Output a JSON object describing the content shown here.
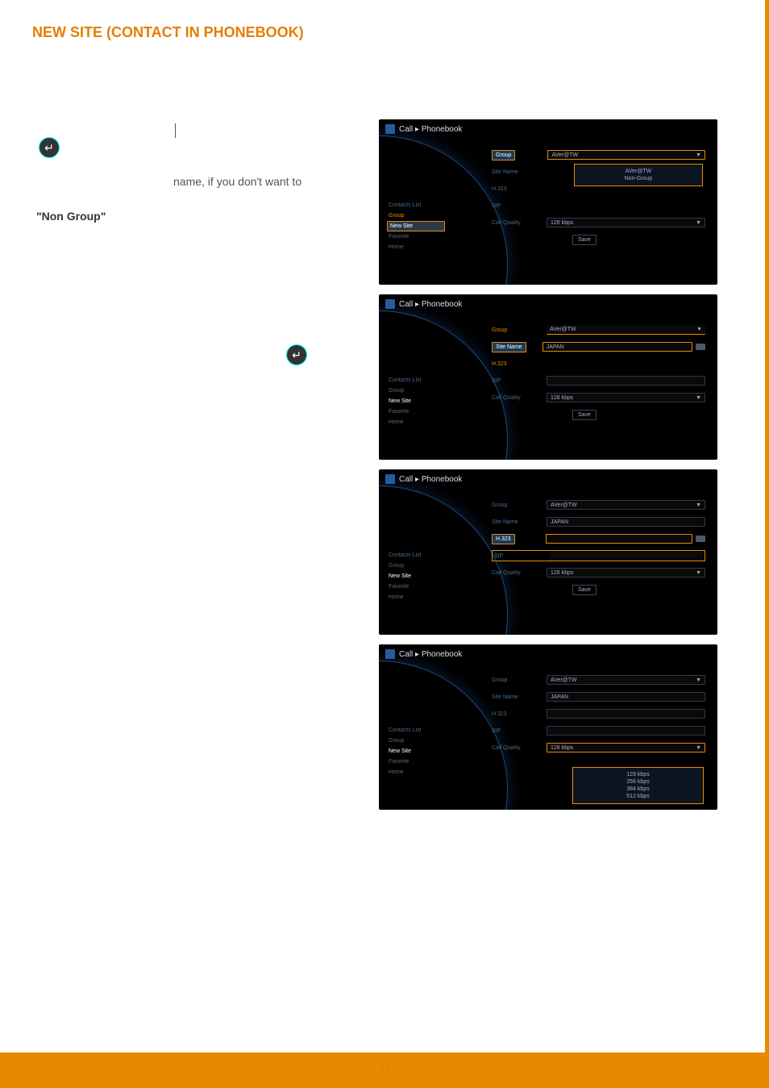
{
  "pageTitle": "NEW SITE (CONTACT IN PHONEBOOK)",
  "bodyText": "name, if you don't want to",
  "nonGroup": "\"Non Group\"",
  "pageNumber": "32",
  "shared": {
    "breadcrumb_call": "Call",
    "breadcrumb_sep": "▸",
    "breadcrumb_phonebook": "Phonebook",
    "sidebar": {
      "contacts": "Contacts List",
      "group": "Group",
      "newsite": "New Site",
      "favorite": "Favorite",
      "home": "Home"
    },
    "labels": {
      "group": "Group",
      "sitename": "Site Name",
      "h323": "H.323",
      "sip": "SIP",
      "callquality": "Call Quality"
    },
    "save": "Save"
  },
  "shot1": {
    "group": "AVer@TW",
    "dropdown": {
      "line1": "AVer@TW",
      "line2": "Non-Group"
    },
    "sitename": "",
    "h323": "",
    "sip": "",
    "quality": "128 kbps"
  },
  "shot2": {
    "group": "AVer@TW",
    "sitename": "JAPAN",
    "h323": "",
    "sip": "",
    "quality": "128 kbps"
  },
  "shot3": {
    "group": "AVer@TW",
    "sitename": "JAPAN",
    "h323": "",
    "sip": "",
    "quality": "128 kbps"
  },
  "shot4": {
    "group": "AVer@TW",
    "sitename": "JAPAN",
    "h323": "",
    "sip": "",
    "quality": "128 kbps",
    "dropdown": {
      "o1": "128 kbps",
      "o2": "256 kbps",
      "o3": "384 kbps",
      "o4": "512 kbps"
    }
  }
}
